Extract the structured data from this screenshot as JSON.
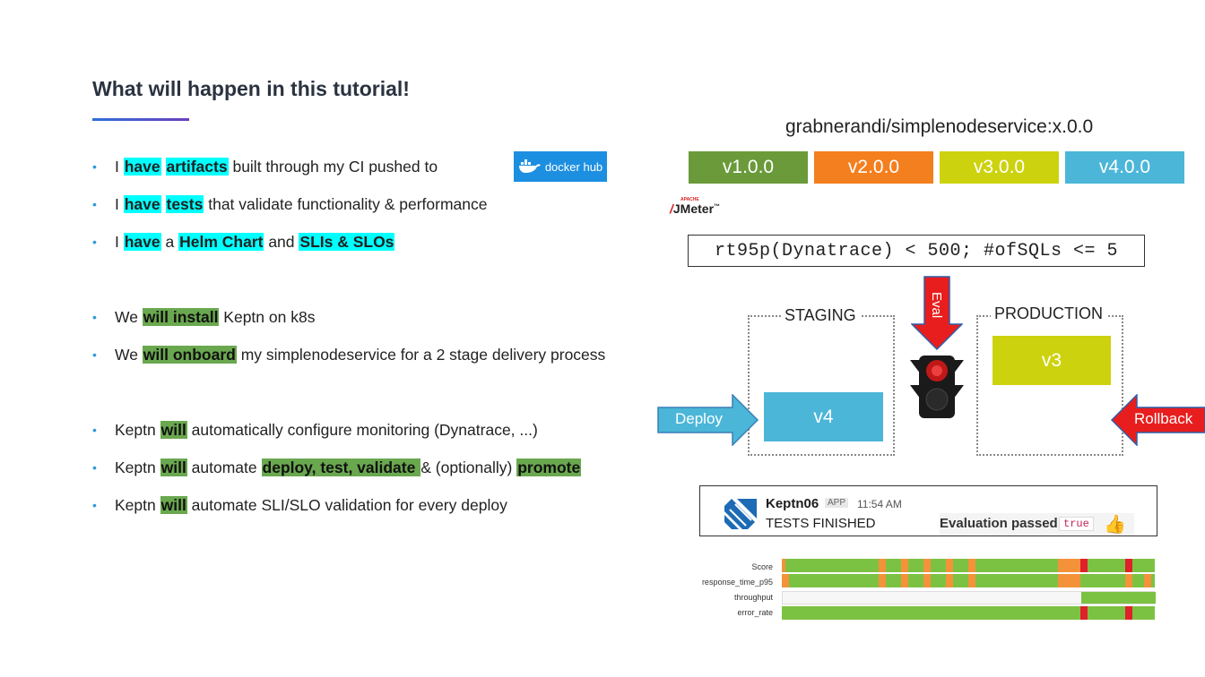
{
  "title": "What will happen in this tutorial!",
  "bullets": [
    {
      "segments": [
        {
          "t": "I "
        },
        {
          "t": "have",
          "hl": "cyan"
        },
        {
          "t": " "
        },
        {
          "t": "artifacts",
          "hl": "cyan"
        },
        {
          "t": " built through my CI pushed to"
        }
      ]
    },
    {
      "segments": [
        {
          "t": "I "
        },
        {
          "t": "have",
          "hl": "cyan"
        },
        {
          "t": " "
        },
        {
          "t": "tests",
          "hl": "cyan"
        },
        {
          "t": " that validate functionality & performance"
        }
      ]
    },
    {
      "segments": [
        {
          "t": "I "
        },
        {
          "t": "have",
          "hl": "cyan"
        },
        {
          "t": " a "
        },
        {
          "t": "Helm Chart",
          "hl": "cyan"
        },
        {
          "t": " and "
        },
        {
          "t": "SLIs & SLOs",
          "hl": "cyan"
        }
      ]
    },
    {
      "segments": [
        {
          "t": "We "
        },
        {
          "t": "will install",
          "hl": "green"
        },
        {
          "t": " Keptn on k8s"
        }
      ]
    },
    {
      "segments": [
        {
          "t": "We "
        },
        {
          "t": "will onboard",
          "hl": "green"
        },
        {
          "t": " my simplenodeservice for a 2 stage delivery process"
        }
      ]
    },
    {
      "segments": [
        {
          "t": "Keptn "
        },
        {
          "t": "will",
          "hl": "green"
        },
        {
          "t": " automatically configure monitoring (Dynatrace, ...)"
        }
      ]
    },
    {
      "segments": [
        {
          "t": "Keptn "
        },
        {
          "t": "will",
          "hl": "green"
        },
        {
          "t": " automate "
        },
        {
          "t": "deploy, test, validate ",
          "hl": "green"
        },
        {
          "t": "& (optionally) "
        },
        {
          "t": "promote",
          "hl": "green"
        }
      ]
    },
    {
      "segments": [
        {
          "t": "Keptn "
        },
        {
          "t": "will",
          "hl": "green"
        },
        {
          "t": " automate SLI/SLO validation for every deploy"
        }
      ]
    }
  ],
  "docker_logo": {
    "text": "docker hub",
    "icon": "docker-whale-icon"
  },
  "image_name": "grabnerandi/simplenodeservice:x.0.0",
  "versions": [
    {
      "label": "v1.0.0",
      "color": "#6a9a3a"
    },
    {
      "label": "v2.0.0",
      "color": "#f47f1e"
    },
    {
      "label": "v3.0.0",
      "color": "#cdd20f"
    },
    {
      "label": "v4.0.0",
      "color": "#4bb6d8"
    }
  ],
  "jmeter": {
    "apache": "APACHE",
    "label": "JMeter",
    "tm": "™"
  },
  "slo_expression": "rt95p(Dynatrace) < 500; #ofSQLs <= 5",
  "stages": {
    "staging": {
      "label": "STAGING",
      "version": "v4",
      "color": "#4bb6d8"
    },
    "production": {
      "label": "PRODUCTION",
      "version": "v3",
      "color": "#cdd20f"
    }
  },
  "arrows": {
    "deploy": "Deploy",
    "eval": "Eval",
    "rollback": "Rollback"
  },
  "colors": {
    "deploy_arrow": "#4bb6d8",
    "eval_arrow": "#e81e1e",
    "rollback_arrow": "#e81e1e",
    "highlight_cyan": "#00ffff",
    "highlight_green": "#6aa84f"
  },
  "slack": {
    "bot_name": "Keptn06",
    "app_badge": "APP",
    "time": "11:54 AM",
    "message": "TESTS FINISHED",
    "eval_label": "Evaluation passed:",
    "eval_value": "true",
    "reaction_icon": "thumbs-up-icon"
  },
  "heatmap": {
    "rows": [
      "Score",
      "response_time_p95",
      "throughput",
      "error_rate"
    ],
    "colors": {
      "pass": "#7cc242",
      "warning": "#f4923a",
      "fail": "#e0202a",
      "empty": "#f7f7f7"
    }
  }
}
